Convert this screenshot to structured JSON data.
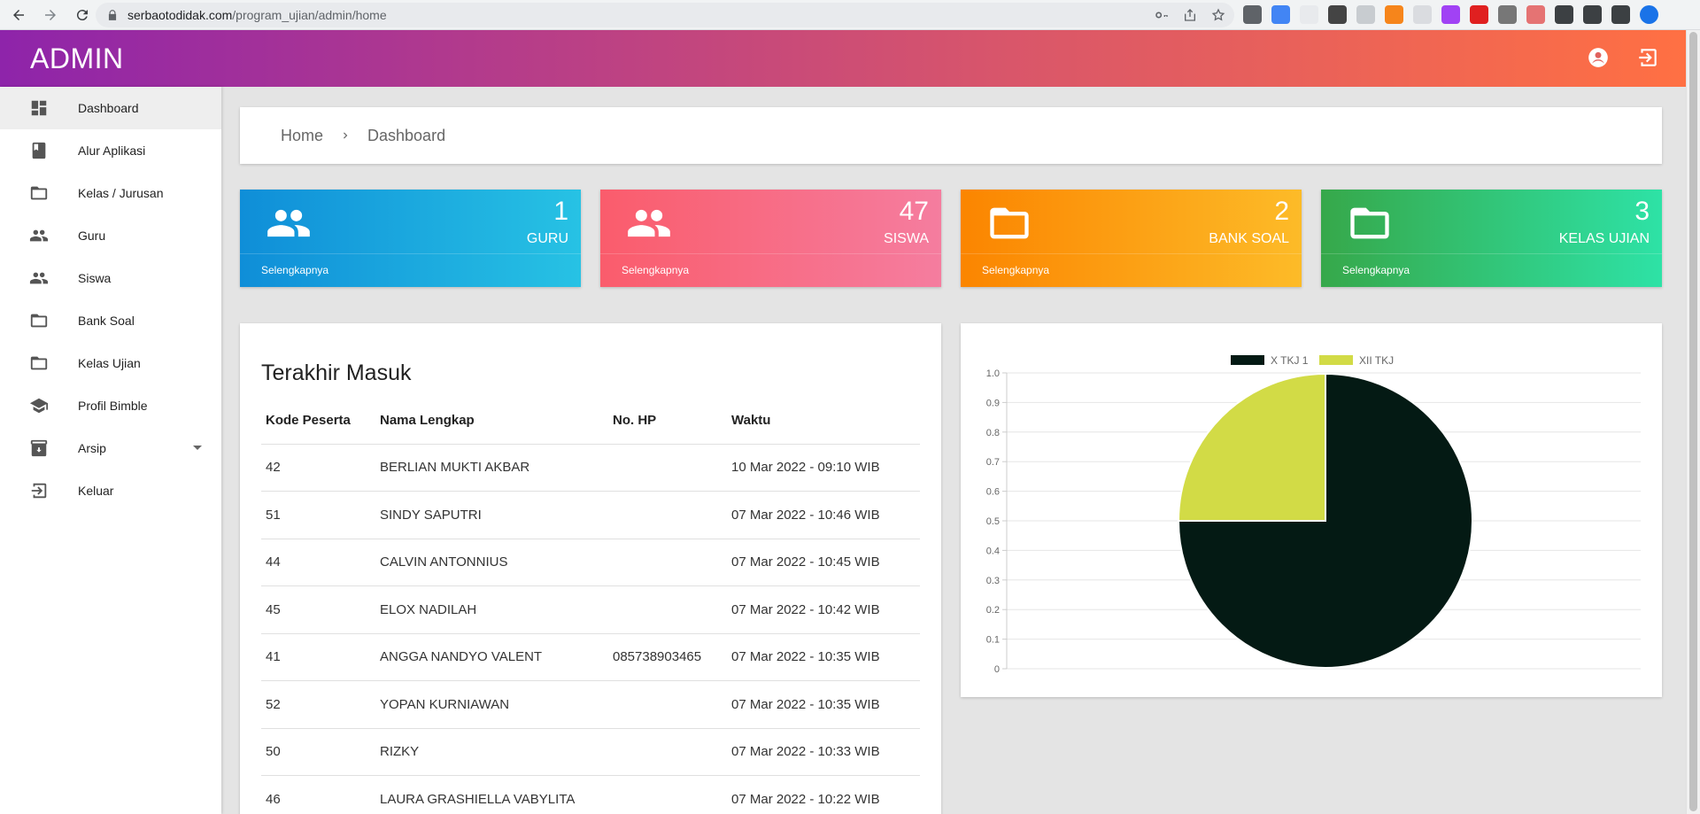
{
  "browser": {
    "url_domain": "serbaotodidak.com",
    "url_path": "/program_ujian/admin/home"
  },
  "header": {
    "brand": "ADMIN"
  },
  "sidebar": {
    "items": [
      {
        "label": "Dashboard",
        "icon": "dashboard-icon"
      },
      {
        "label": "Alur Aplikasi",
        "icon": "book-icon"
      },
      {
        "label": "Kelas / Jurusan",
        "icon": "folder-icon"
      },
      {
        "label": "Guru",
        "icon": "people-icon"
      },
      {
        "label": "Siswa",
        "icon": "people-icon"
      },
      {
        "label": "Bank Soal",
        "icon": "folder-icon"
      },
      {
        "label": "Kelas Ujian",
        "icon": "folder-icon"
      },
      {
        "label": "Profil Bimble",
        "icon": "school-icon"
      },
      {
        "label": "Arsip",
        "icon": "archive-icon"
      },
      {
        "label": "Keluar",
        "icon": "logout-icon"
      }
    ]
  },
  "breadcrumb": {
    "home": "Home",
    "current": "Dashboard"
  },
  "stats": [
    {
      "value": "1",
      "label": "GURU",
      "more": "Selengkapnya",
      "icon": "people-icon",
      "color_from": "#0f8ed8",
      "color_to": "#27c2e4"
    },
    {
      "value": "47",
      "label": "SISWA",
      "more": "Selengkapnya",
      "icon": "people-icon",
      "color_from": "#fa5c6c",
      "color_to": "#f57d9f"
    },
    {
      "value": "2",
      "label": "BANK SOAL",
      "more": "Selengkapnya",
      "icon": "folder-icon",
      "color_from": "#fb8500",
      "color_to": "#fdbb28"
    },
    {
      "value": "3",
      "label": "KELAS UJIAN",
      "more": "Selengkapnya",
      "icon": "folder-icon",
      "color_from": "#36a84a",
      "color_to": "#2ee2a6"
    }
  ],
  "recent": {
    "title": "Terakhir Masuk",
    "columns": [
      "Kode Peserta",
      "Nama Lengkap",
      "No. HP",
      "Waktu"
    ],
    "rows": [
      [
        "42",
        "BERLIAN MUKTI AKBAR",
        "",
        "10 Mar 2022 - 09:10 WIB"
      ],
      [
        "51",
        "SINDY SAPUTRI",
        "",
        "07 Mar 2022 - 10:46 WIB"
      ],
      [
        "44",
        "CALVIN ANTONNIUS",
        "",
        "07 Mar 2022 - 10:45 WIB"
      ],
      [
        "45",
        "ELOX NADILAH",
        "",
        "07 Mar 2022 - 10:42 WIB"
      ],
      [
        "41",
        "ANGGA NANDYO VALENT",
        "085738903465",
        "07 Mar 2022 - 10:35 WIB"
      ],
      [
        "52",
        "YOPAN KURNIAWAN",
        "",
        "07 Mar 2022 - 10:35 WIB"
      ],
      [
        "50",
        "RIZKY",
        "",
        "07 Mar 2022 - 10:33 WIB"
      ],
      [
        "46",
        "LAURA GRASHIELLA VABYLITA",
        "",
        "07 Mar 2022 - 10:22 WIB"
      ]
    ]
  },
  "chart_data": {
    "type": "pie",
    "title": "",
    "legend_position": "top",
    "grid": true,
    "ylim": [
      0,
      1.0
    ],
    "yticks": [
      "1.0",
      "0.9",
      "0.8",
      "0.7",
      "0.6",
      "0.5",
      "0.4",
      "0.3",
      "0.2",
      "0.1",
      "0"
    ],
    "categories": [
      "X TKJ 1",
      "XII TKJ"
    ],
    "values": [
      0.75,
      0.25
    ],
    "colors": [
      "#041a14",
      "#d2db46"
    ]
  }
}
